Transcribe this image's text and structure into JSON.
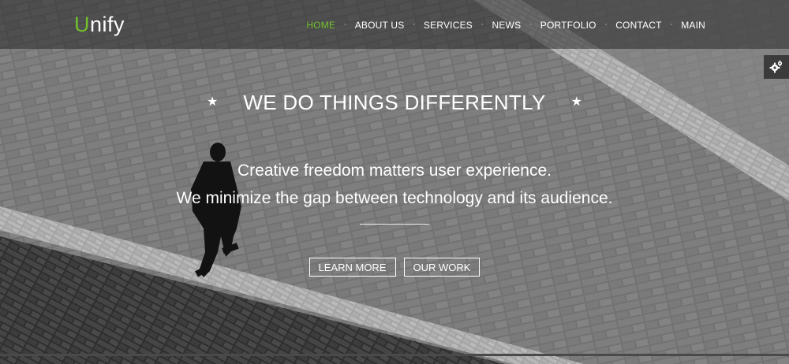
{
  "brand": {
    "logo_first": "U",
    "logo_rest": "nify",
    "accent": "#72c02c"
  },
  "nav": {
    "items": [
      {
        "label": "HOME",
        "active": true
      },
      {
        "label": "ABOUT US",
        "active": false
      },
      {
        "label": "SERVICES",
        "active": false
      },
      {
        "label": "NEWS",
        "active": false
      },
      {
        "label": "PORTFOLIO",
        "active": false
      },
      {
        "label": "CONTACT",
        "active": false
      },
      {
        "label": "MAIN",
        "active": false
      }
    ],
    "separator": "◦"
  },
  "hero": {
    "headline": "WE DO THINGS DIFFERENTLY",
    "star": "★",
    "line1": "Creative freedom matters user experience.",
    "line2": "We minimize the gap between technology and its audience.",
    "buttons": {
      "learn_more": "LEARN MORE",
      "our_work": "OUR WORK"
    }
  },
  "icons": {
    "settings": "gears-icon",
    "decoration": "star-icon"
  }
}
